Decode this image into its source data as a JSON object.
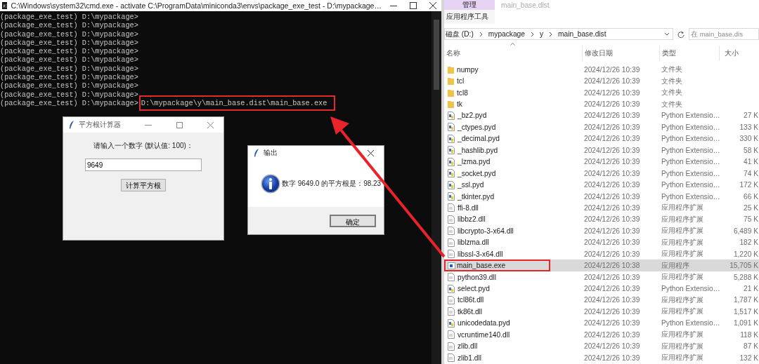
{
  "terminal": {
    "title": "C:\\Windows\\system32\\cmd.exe - activate  C:\\ProgramData\\miniconda3\\envs\\package_exe_test - D:\\mypackage…",
    "lines": [
      {
        "prompt": "(package_exe_test) D:\\mypackage>"
      },
      {
        "prompt": "(package_exe_test) D:\\mypackage>"
      },
      {
        "prompt": "(package_exe_test) D:\\mypackage>"
      },
      {
        "prompt": "(package_exe_test) D:\\mypackage>"
      },
      {
        "prompt": "(package_exe_test) D:\\mypackage>"
      },
      {
        "prompt": "(package_exe_test) D:\\mypackage>"
      },
      {
        "prompt": "(package_exe_test) D:\\mypackage>"
      },
      {
        "prompt": "(package_exe_test) D:\\mypackage>"
      },
      {
        "prompt": "(package_exe_test) D:\\mypackage>"
      },
      {
        "prompt": "(package_exe_test) D:\\mypackage>"
      },
      {
        "prompt": "(package_exe_test) D:\\mypackage>",
        "command": "D:\\mypackage\\y\\main_base.dist\\main_base.exe"
      }
    ]
  },
  "calculator": {
    "title": "平方根计算器",
    "prompt": "请输入一个数字 (默认值: 100)：",
    "value": "9649",
    "button": "计算平方根"
  },
  "dialog": {
    "title": "输出",
    "message": "数字 9649.0 的平方根是：98.23",
    "button": "确定"
  },
  "explorer": {
    "ribbon_tab": "管理",
    "window_title": "main_base.dist",
    "ribbon_group": "应用程序工具",
    "breadcrumb": [
      "磁盘 (D:)",
      "mypackage",
      "y",
      "main_base.dist"
    ],
    "search": {
      "placeholder": "在 main_base.dis"
    },
    "columns": [
      "名称",
      "修改日期",
      "类型",
      "大小"
    ],
    "rows": [
      {
        "kind": "folder",
        "name": "numpy",
        "date": "2024/12/26 10:39",
        "type": "文件夹",
        "selected": false
      },
      {
        "kind": "folder",
        "name": "tcl",
        "date": "2024/12/26 10:39",
        "type": "文件夹",
        "selected": false
      },
      {
        "kind": "folder",
        "name": "tcl8",
        "date": "2024/12/26 10:39",
        "type": "文件夹",
        "selected": false
      },
      {
        "kind": "folder",
        "name": "tk",
        "date": "2024/12/26 10:39",
        "type": "文件夹",
        "selected": false
      },
      {
        "kind": "python",
        "name": "_bz2.pyd",
        "date": "2024/12/26 10:39",
        "type": "Python Extensio…",
        "size": "27 K",
        "selected": false
      },
      {
        "kind": "python",
        "name": "_ctypes.pyd",
        "date": "2024/12/26 10:39",
        "type": "Python Extensio…",
        "size": "133 K",
        "selected": false
      },
      {
        "kind": "python",
        "name": "_decimal.pyd",
        "date": "2024/12/26 10:39",
        "type": "Python Extensio…",
        "size": "330 K",
        "selected": false
      },
      {
        "kind": "python",
        "name": "_hashlib.pyd",
        "date": "2024/12/26 10:39",
        "type": "Python Extensio…",
        "size": "58 K",
        "selected": false
      },
      {
        "kind": "python",
        "name": "_lzma.pyd",
        "date": "2024/12/26 10:39",
        "type": "Python Extensio…",
        "size": "41 K",
        "selected": false
      },
      {
        "kind": "python",
        "name": "_socket.pyd",
        "date": "2024/12/26 10:39",
        "type": "Python Extensio…",
        "size": "74 K",
        "selected": false
      },
      {
        "kind": "python",
        "name": "_ssl.pyd",
        "date": "2024/12/26 10:39",
        "type": "Python Extensio…",
        "size": "172 K",
        "selected": false
      },
      {
        "kind": "python",
        "name": "_tkinter.pyd",
        "date": "2024/12/26 10:39",
        "type": "Python Extensio…",
        "size": "66 K",
        "selected": false
      },
      {
        "kind": "dll",
        "name": "ffi-8.dll",
        "date": "2024/12/26 10:39",
        "type": "应用程序扩展",
        "size": "25 K",
        "selected": false
      },
      {
        "kind": "dll",
        "name": "libbz2.dll",
        "date": "2024/12/26 10:39",
        "type": "应用程序扩展",
        "size": "75 K",
        "selected": false
      },
      {
        "kind": "dll",
        "name": "libcrypto-3-x64.dll",
        "date": "2024/12/26 10:39",
        "type": "应用程序扩展",
        "size": "6,489 K",
        "selected": false
      },
      {
        "kind": "dll",
        "name": "liblzma.dll",
        "date": "2024/12/26 10:39",
        "type": "应用程序扩展",
        "size": "182 K",
        "selected": false
      },
      {
        "kind": "dll",
        "name": "libssl-3-x64.dll",
        "date": "2024/12/26 10:39",
        "type": "应用程序扩展",
        "size": "1,220 K",
        "selected": false
      },
      {
        "kind": "exe",
        "name": "main_base.exe",
        "date": "2024/12/26 10:38",
        "type": "应用程序",
        "size": "15,705 K",
        "selected": true
      },
      {
        "kind": "dll",
        "name": "python39.dll",
        "date": "2024/12/26 10:39",
        "type": "应用程序扩展",
        "size": "5,288 K",
        "selected": false
      },
      {
        "kind": "python",
        "name": "select.pyd",
        "date": "2024/12/26 10:39",
        "type": "Python Extensio…",
        "size": "21 K",
        "selected": false
      },
      {
        "kind": "dll",
        "name": "tcl86t.dll",
        "date": "2024/12/26 10:39",
        "type": "应用程序扩展",
        "size": "1,787 K",
        "selected": false
      },
      {
        "kind": "dll",
        "name": "tk86t.dll",
        "date": "2024/12/26 10:39",
        "type": "应用程序扩展",
        "size": "1,517 K",
        "selected": false
      },
      {
        "kind": "python",
        "name": "unicodedata.pyd",
        "date": "2024/12/26 10:39",
        "type": "Python Extensio…",
        "size": "1,091 K",
        "selected": false
      },
      {
        "kind": "dll",
        "name": "vcruntime140.dll",
        "date": "2024/12/26 10:39",
        "type": "应用程序扩展",
        "size": "118 K",
        "selected": false
      },
      {
        "kind": "dll",
        "name": "zlib.dll",
        "date": "2024/12/26 10:39",
        "type": "应用程序扩展",
        "size": "87 K",
        "selected": false
      },
      {
        "kind": "dll",
        "name": "zlib1.dll",
        "date": "2024/12/26 10:39",
        "type": "应用程序扩展",
        "size": "132 K",
        "selected": false
      }
    ]
  }
}
